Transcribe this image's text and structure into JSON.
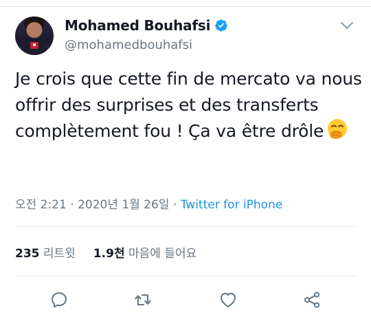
{
  "user": {
    "display_name": "Mohamed Bouhafsi",
    "handle": "@mohamedbouhafsi",
    "verified": true
  },
  "tweet": {
    "text": "Je crois que cette fin de mercato va nous offrir des surprises et des transferts complètement fou ! Ça va être drôle",
    "emoji": "face-with-hand-over-mouth"
  },
  "meta": {
    "timestamp": "오전 2:21 · 2020년 1월 26일",
    "separator": " · ",
    "source": "Twitter for iPhone"
  },
  "stats": {
    "retweets_count": "235",
    "retweets_label": "리트윗",
    "likes_count": "1.9천",
    "likes_label": "마음에 들어요"
  },
  "actions": {
    "reply_icon": "reply-icon",
    "retweet_icon": "retweet-icon",
    "like_icon": "heart-icon",
    "share_icon": "share-icon"
  },
  "colors": {
    "text": "#141823",
    "secondary": "#657786",
    "link": "#1b95e0",
    "verified": "#1da1f2"
  }
}
